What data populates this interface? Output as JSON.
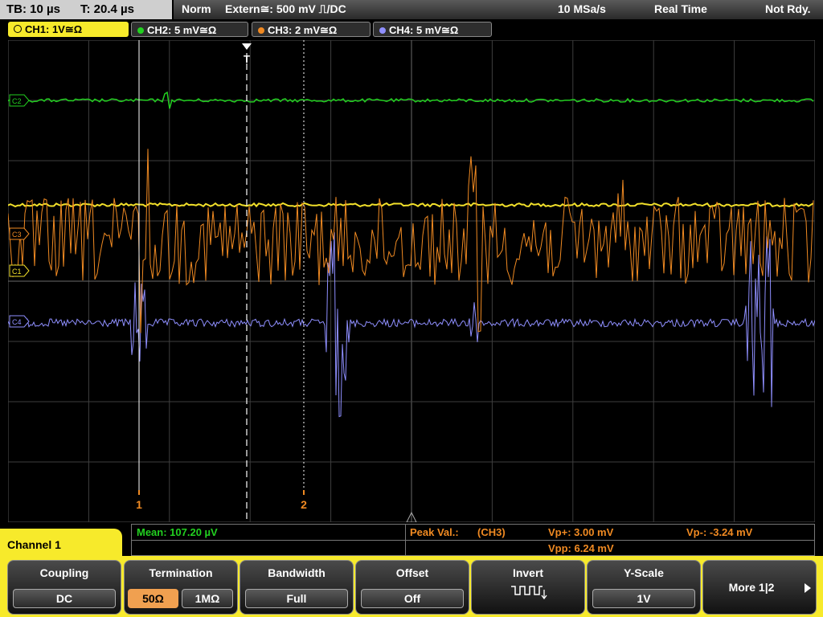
{
  "timebase": {
    "tb_label": "TB: 10 µs",
    "t_label": "T: 20.4 µs"
  },
  "status": {
    "mode": "Norm",
    "trigger": "Extern≅: 500 mV ⎍/DC",
    "sample_rate": "10 MSa/s",
    "acq_mode": "Real Time",
    "trig_state": "Not Rdy."
  },
  "channels": [
    {
      "label": "CH1: 1V≅Ω",
      "color": "#f2e02a",
      "marker": "C1"
    },
    {
      "label": "CH2: 5 mV≅Ω",
      "color": "#22d020",
      "marker": "C2"
    },
    {
      "label": "CH3: 2 mV≅Ω",
      "color": "#f08a22",
      "marker": "C3"
    },
    {
      "label": "CH4: 5 mV≅Ω",
      "color": "#8f8fff",
      "marker": "C4"
    }
  ],
  "cursors": {
    "c1": "1",
    "c2": "2",
    "trigger_marker": "T"
  },
  "measurement": {
    "mean": "Mean: 107.20 µV",
    "peak_label": "Peak Val.:",
    "peak_source": "(CH3)",
    "vp_plus": "Vp+: 3.00 mV",
    "vp_minus": "Vp-: -3.24 mV",
    "vpp": "Vpp: 6.24 mV"
  },
  "menu": {
    "title": "Channel 1",
    "coupling": {
      "title": "Coupling",
      "value": "DC"
    },
    "termination": {
      "title": "Termination",
      "opt1": "50Ω",
      "opt2": "1MΩ"
    },
    "bandwidth": {
      "title": "Bandwidth",
      "value": "Full"
    },
    "offset": {
      "title": "Offset",
      "value": "Off"
    },
    "invert": {
      "title": "Invert"
    },
    "yscale": {
      "title": "Y-Scale",
      "value": "1V"
    },
    "more": {
      "label": "More 1|2"
    }
  },
  "colors": {
    "softkey_accent": "#f7ea2b",
    "selected_option": "#f0a050",
    "grid": "#5a5a5a"
  }
}
